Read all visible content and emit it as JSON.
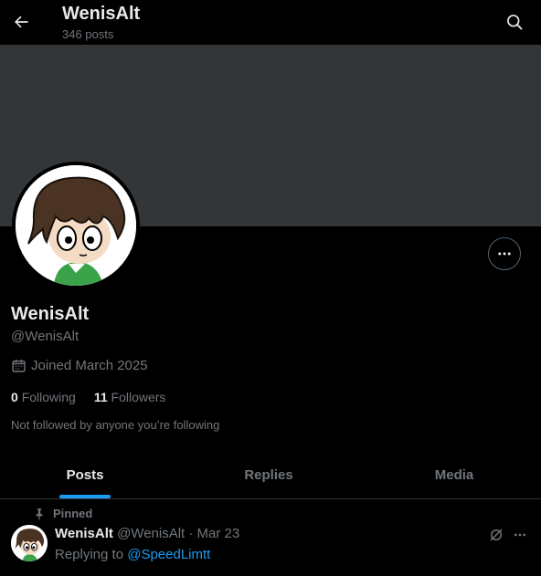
{
  "header": {
    "title": "WenisAlt",
    "post_count": "346 posts"
  },
  "profile": {
    "display_name": "WenisAlt",
    "handle": "@WenisAlt",
    "joined": "Joined March 2025",
    "following_count": "0",
    "following_label": "Following",
    "followers_count": "11",
    "followers_label": "Followers",
    "followed_note": "Not followed by anyone you’re following"
  },
  "tabs": [
    {
      "label": "Posts",
      "active": true
    },
    {
      "label": "Replies",
      "active": false
    },
    {
      "label": "Media",
      "active": false
    }
  ],
  "post": {
    "pinned_label": "Pinned",
    "author_name": "WenisAlt",
    "author_meta": "@WenisAlt · Mar 23",
    "replying_prefix": "Replying to",
    "replying_to": "@SpeedLimtt"
  },
  "colors": {
    "background": "#000000",
    "banner": "#333639",
    "accent": "#1d9bf0",
    "muted_text": "#71767b"
  },
  "icons": [
    "back-arrow-icon",
    "search-icon",
    "more-horizontal-icon",
    "calendar-icon",
    "pin-icon",
    "grok-icon"
  ]
}
